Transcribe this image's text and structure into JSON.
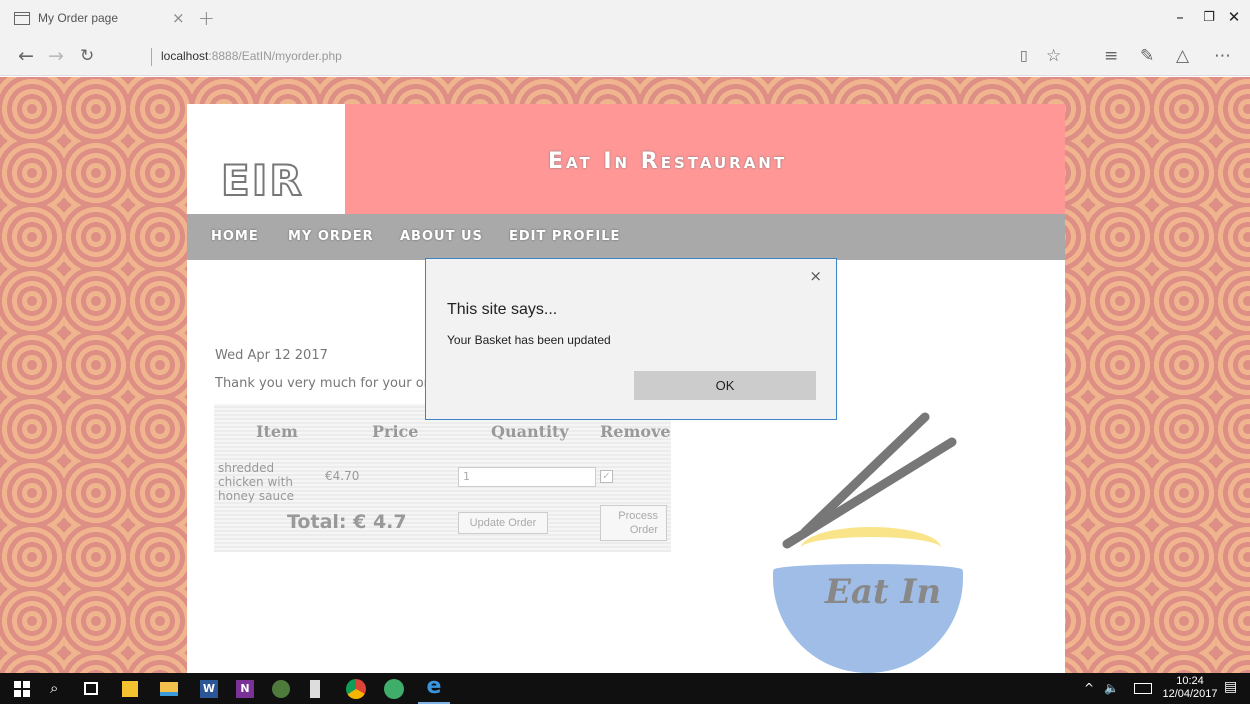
{
  "browser": {
    "tab_title": "My Order page",
    "tab_close": "×",
    "new_tab": "+",
    "url_host": "localhost",
    "url_path": ":8888/EatIN/myorder.php",
    "minimize": "–",
    "restore": "❐",
    "close": "✕"
  },
  "site": {
    "logo": "EIR",
    "title": "Eat In Restaurant",
    "nav": [
      "HOME",
      "MY ORDER",
      "ABOUT US",
      "EDIT PROFILE"
    ],
    "date": "Wed Apr 12 2017",
    "thanks": "Thank you very much for your order"
  },
  "order": {
    "headers": [
      "Item",
      "Price",
      "Quantity",
      "Remove"
    ],
    "item_name": "shredded chicken with honey sauce",
    "item_price": "€4.70",
    "quantity": "1",
    "total": "Total: € 4.7",
    "update_button": "Update Order",
    "process_button": "Process Order"
  },
  "logo_image": {
    "text": "Eat In"
  },
  "dialog": {
    "title": "This site says...",
    "message": "Your Basket has been updated",
    "ok": "OK",
    "close": "×"
  },
  "taskbar": {
    "time": "10:24",
    "date": "12/04/2017"
  },
  "colors": {
    "banner": "#ff9797",
    "navbar": "#a9a9a9",
    "dialog_border": "#3c84c6",
    "bowl": "#9fbde6"
  }
}
